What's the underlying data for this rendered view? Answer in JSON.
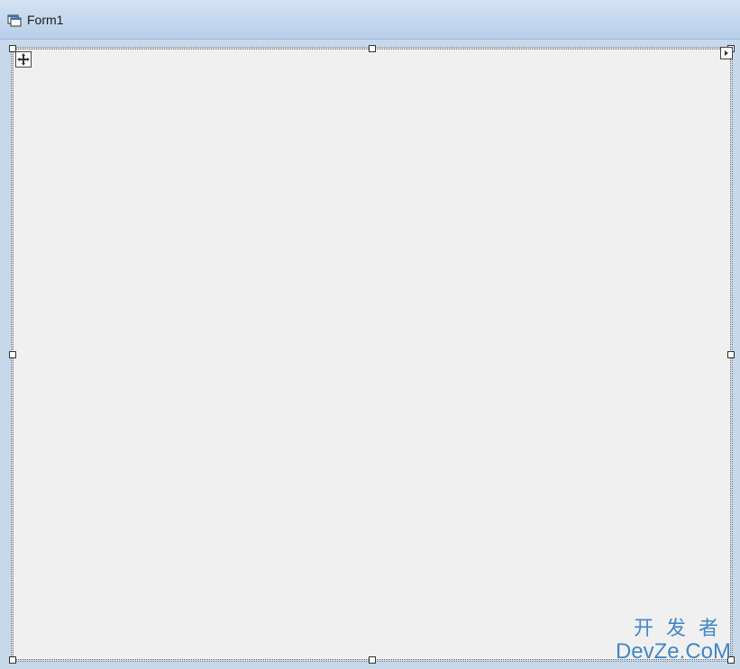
{
  "window": {
    "title": "Form1"
  },
  "watermark": {
    "line1": "开发者",
    "line2": "DevZe.CoM"
  }
}
